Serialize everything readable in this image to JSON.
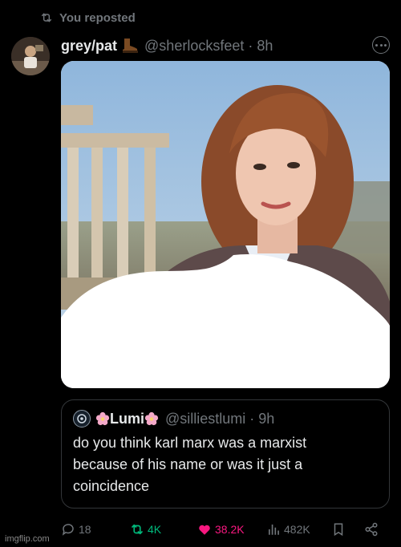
{
  "repost_banner": {
    "text": "You reposted"
  },
  "tweet": {
    "display_name": "grey/pat",
    "handle": "@sherlocksfeet",
    "separator": "·",
    "time": "8h"
  },
  "quoted_tweet": {
    "display_name": "Lumi",
    "handle": "@silliestlumi",
    "separator": "·",
    "time": "9h",
    "text": "do you think karl marx was a marxist\nbecause of his name or was it just a\ncoincidence"
  },
  "actions": {
    "replies": "18",
    "reposts": "4K",
    "likes": "38.2K",
    "views": "482K"
  },
  "colors": {
    "background": "#000000",
    "muted": "#71767b",
    "repost_green": "#00ba7c",
    "like_pink": "#f91880",
    "border": "#333639"
  },
  "icons": [
    "repost-icon",
    "boot-icon",
    "more-icon",
    "reply-icon",
    "like-icon",
    "views-icon",
    "bookmark-icon",
    "share-icon",
    "flower-icon"
  ],
  "watermark": "imgflip.com"
}
